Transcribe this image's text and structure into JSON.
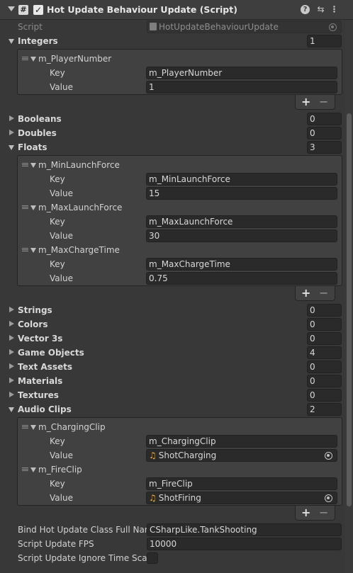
{
  "header": {
    "title": "Hot Update Behaviour Update (Script)",
    "script_icon": "#",
    "enabled_check": "✓",
    "icons": [
      "help-icon",
      "settings-sliders-icon",
      "more-vert-icon"
    ]
  },
  "script_field": {
    "label": "Script",
    "value": "HotUpdateBehaviourUpdate"
  },
  "integers": {
    "label": "Integers",
    "count": "1",
    "items": [
      {
        "name": "m_PlayerNumber",
        "key_label": "Key",
        "key": "m_PlayerNumber",
        "value_label": "Value",
        "value": "1"
      }
    ]
  },
  "booleans": {
    "label": "Booleans",
    "count": "0"
  },
  "doubles": {
    "label": "Doubles",
    "count": "0"
  },
  "floats": {
    "label": "Floats",
    "count": "3",
    "items": [
      {
        "name": "m_MinLaunchForce",
        "key_label": "Key",
        "key": "m_MinLaunchForce",
        "value_label": "Value",
        "value": "15"
      },
      {
        "name": "m_MaxLaunchForce",
        "key_label": "Key",
        "key": "m_MaxLaunchForce",
        "value_label": "Value",
        "value": "30"
      },
      {
        "name": "m_MaxChargeTime",
        "key_label": "Key",
        "key": "m_MaxChargeTime",
        "value_label": "Value",
        "value": "0.75"
      }
    ]
  },
  "strings": {
    "label": "Strings",
    "count": "0"
  },
  "colors": {
    "label": "Colors",
    "count": "0"
  },
  "vector3s": {
    "label": "Vector 3s",
    "count": "0"
  },
  "game_objects": {
    "label": "Game Objects",
    "count": "4"
  },
  "text_assets": {
    "label": "Text Assets",
    "count": "0"
  },
  "materials": {
    "label": "Materials",
    "count": "0"
  },
  "textures": {
    "label": "Textures",
    "count": "0"
  },
  "audio_clips": {
    "label": "Audio Clips",
    "count": "2",
    "items": [
      {
        "name": "m_ChargingClip",
        "key_label": "Key",
        "key": "m_ChargingClip",
        "value_label": "Value",
        "value": "ShotCharging"
      },
      {
        "name": "m_FireClip",
        "key_label": "Key",
        "key": "m_FireClip",
        "value_label": "Value",
        "value": "ShotFiring"
      }
    ]
  },
  "list_buttons": {
    "add": "+",
    "remove": "−"
  },
  "bind_class": {
    "label": "Bind Hot Update Class Full Name",
    "value": "CSharpLike.TankShooting"
  },
  "update_fps": {
    "label": "Script Update FPS",
    "value": "10000"
  },
  "ignore_time_scale": {
    "label": "Script Update Ignore Time Scale",
    "checked": false
  },
  "colors_theme": {
    "background": "#383838",
    "field": "#2a2a2a",
    "text": "#d2d2d2",
    "audio_icon": "#e8b04a"
  }
}
